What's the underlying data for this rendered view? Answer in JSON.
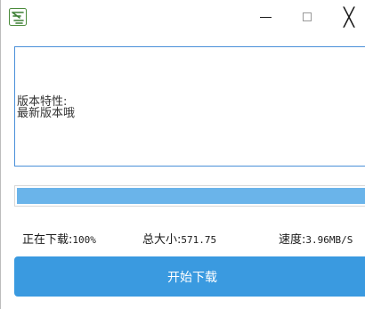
{
  "window": {
    "icon": "app-logo-icon",
    "controls": {
      "minimize": "minimize-icon",
      "maximize": "maximize-icon",
      "close_symbol": "╳",
      "close": "close-icon"
    }
  },
  "notes": {
    "lines": [
      "版本特性:",
      "最新版本哦"
    ]
  },
  "progress": {
    "fraction": 1.0,
    "color": "#6ab4ea"
  },
  "status": {
    "downloading_label": "正在下载:",
    "downloading_value": "100%",
    "size_label": "总大小:",
    "size_value": "571.75",
    "speed_label": "速度:",
    "speed_value": "3.96MB/S"
  },
  "start_button": {
    "label": "开始下载",
    "color": "#3a9ae0"
  }
}
